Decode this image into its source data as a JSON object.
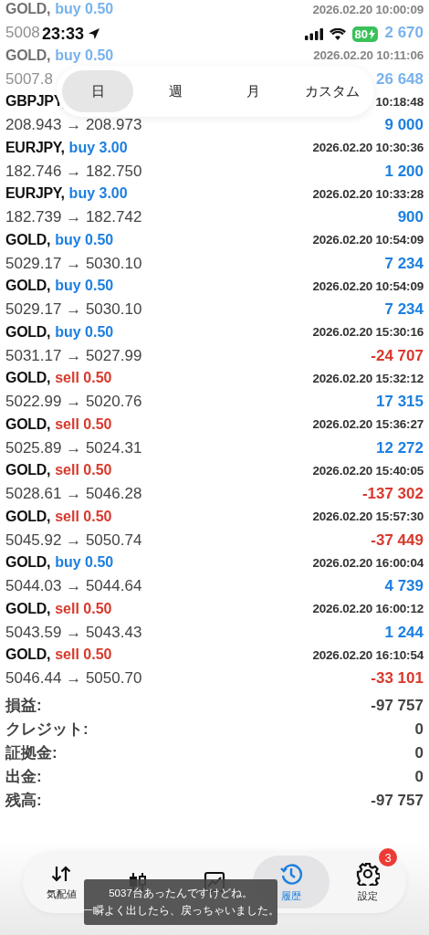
{
  "status_bar": {
    "time": "23:33",
    "battery": "80",
    "charging": true
  },
  "period_tabs": [
    {
      "label": "日",
      "selected": true
    },
    {
      "label": "週",
      "selected": false
    },
    {
      "label": "月",
      "selected": false
    },
    {
      "label": "カスタム",
      "selected": false
    }
  ],
  "deals": [
    {
      "symbol": "GOLD,",
      "order": "buy 0.50",
      "kind": "buy",
      "time": "2026.02.20 10:00:09",
      "prices": "5008",
      "profit": "2 670",
      "loss": false,
      "faded": true
    },
    {
      "symbol": "GOLD,",
      "order": "buy 0.50",
      "kind": "buy",
      "time": "2026.02.20 10:11:06",
      "prices": "5007.8",
      "profit": "26 648",
      "loss": false,
      "faded": true
    },
    {
      "symbol": "GBPJPY,",
      "time": "10:18:48",
      "prices": "208.943 → 208.973",
      "profit": "9 000",
      "loss": false,
      "faded": false
    },
    {
      "symbol": "EURJPY,",
      "order": "buy 3.00",
      "kind": "buy",
      "time": "2026.02.20 10:30:36",
      "prices": "182.746 → 182.750",
      "profit": "1 200",
      "loss": false,
      "faded": false
    },
    {
      "symbol": "EURJPY,",
      "order": "buy 3.00",
      "kind": "buy",
      "time": "2026.02.20 10:33:28",
      "prices": "182.739 → 182.742",
      "profit": "900",
      "loss": false,
      "faded": false
    },
    {
      "symbol": "GOLD,",
      "order": "buy 0.50",
      "kind": "buy",
      "time": "2026.02.20 10:54:09",
      "prices": "5029.17 → 5030.10",
      "profit": "7 234",
      "loss": false,
      "faded": false
    },
    {
      "symbol": "GOLD,",
      "order": "buy 0.50",
      "kind": "buy",
      "time": "2026.02.20 10:54:09",
      "prices": "5029.17 → 5030.10",
      "profit": "7 234",
      "loss": false,
      "faded": false
    },
    {
      "symbol": "GOLD,",
      "order": "buy 0.50",
      "kind": "buy",
      "time": "2026.02.20 15:30:16",
      "prices": "5031.17 → 5027.99",
      "profit": "-24 707",
      "loss": true,
      "faded": false
    },
    {
      "symbol": "GOLD,",
      "order": "sell 0.50",
      "kind": "sell",
      "time": "2026.02.20 15:32:12",
      "prices": "5022.99 → 5020.76",
      "profit": "17 315",
      "loss": false,
      "faded": false
    },
    {
      "symbol": "GOLD,",
      "order": "sell 0.50",
      "kind": "sell",
      "time": "2026.02.20 15:36:27",
      "prices": "5025.89 → 5024.31",
      "profit": "12 272",
      "loss": false,
      "faded": false
    },
    {
      "symbol": "GOLD,",
      "order": "sell 0.50",
      "kind": "sell",
      "time": "2026.02.20 15:40:05",
      "prices": "5028.61 → 5046.28",
      "profit": "-137 302",
      "loss": true,
      "faded": false
    },
    {
      "symbol": "GOLD,",
      "order": "sell 0.50",
      "kind": "sell",
      "time": "2026.02.20 15:57:30",
      "prices": "5045.92 → 5050.74",
      "profit": "-37 449",
      "loss": true,
      "faded": false
    },
    {
      "symbol": "GOLD,",
      "order": "buy 0.50",
      "kind": "buy",
      "time": "2026.02.20 16:00:04",
      "prices": "5044.03 → 5044.64",
      "profit": "4 739",
      "loss": false,
      "faded": false
    },
    {
      "symbol": "GOLD,",
      "order": "sell 0.50",
      "kind": "sell",
      "time": "2026.02.20 16:00:12",
      "prices": "5043.59 → 5043.43",
      "profit": "1 244",
      "loss": false,
      "faded": false
    },
    {
      "symbol": "GOLD,",
      "order": "sell 0.50",
      "kind": "sell",
      "time": "2026.02.20 16:10:54",
      "prices": "5046.44 → 5050.70",
      "profit": "-33 101",
      "loss": true,
      "faded": false
    }
  ],
  "summary": [
    {
      "label": "損益:",
      "value": "-97 757"
    },
    {
      "label": "クレジット:",
      "value": "0"
    },
    {
      "label": "証拠金:",
      "value": "0"
    },
    {
      "label": "出金:",
      "value": "0"
    },
    {
      "label": "残高:",
      "value": "-97 757"
    }
  ],
  "nav": [
    {
      "kind": "quotes",
      "label": "気配値",
      "selected": false
    },
    {
      "kind": "chart",
      "selected": false
    },
    {
      "kind": "trade",
      "selected": false
    },
    {
      "kind": "history",
      "label": "履歴",
      "selected": true
    },
    {
      "kind": "settings",
      "label": "設定",
      "selected": false,
      "badge": "3"
    }
  ],
  "caption": {
    "lines": [
      "5037台あったんですけどね。",
      "一瞬よく出したら、戻っちゃいました。"
    ]
  }
}
